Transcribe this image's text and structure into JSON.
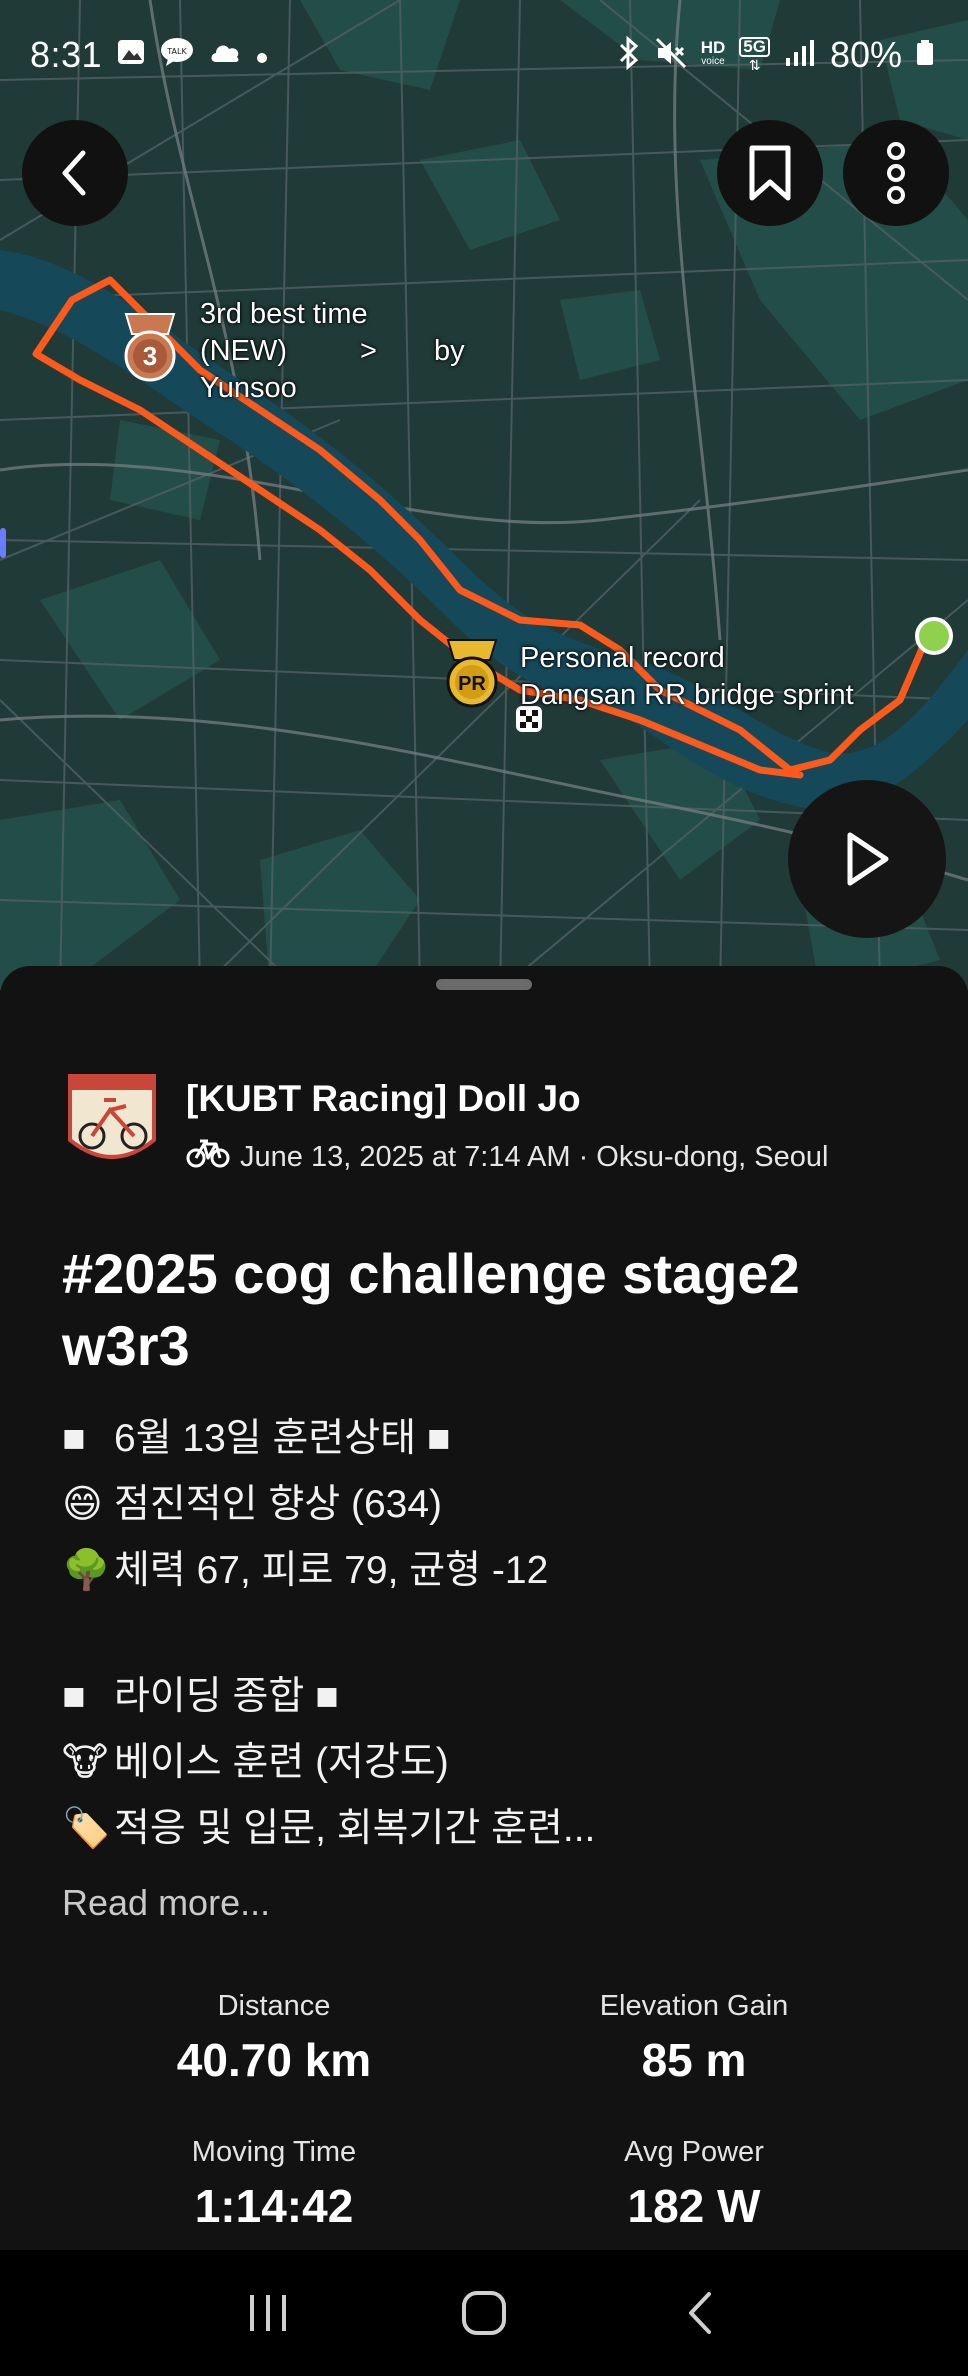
{
  "status_bar": {
    "time": "8:31",
    "left_icons": [
      "gallery-icon",
      "talk-icon",
      "cloud-icon",
      "dot-icon"
    ],
    "right_icons": [
      "bluetooth-icon",
      "mute-icon",
      "hd-voice-icon",
      "5g-icon",
      "signal-icon"
    ],
    "hd_label": "HD",
    "g5_label": "5G",
    "battery": "80%"
  },
  "map": {
    "best_time_label": [
      "3rd best time",
      "(NEW)",
      ">",
      "by",
      "Yunsoo"
    ],
    "best_time_medal": "3",
    "pr_label": [
      "Personal record",
      "Dangsan RR bridge sprint"
    ],
    "pr_medal": "PR",
    "colors": {
      "route": "#fc5a1c",
      "start_dot": "#8fd14f",
      "river": "#15495a",
      "land": "#1f3a37"
    }
  },
  "activity": {
    "athlete_name": "[KUBT Racing] Doll Jo",
    "meta": "June 13, 2025 at 7:14 AM · Oksu-dong, Seoul",
    "title": "#2025 cog challenge stage2 w3r3",
    "description": [
      {
        "emoji": "■",
        "text": "6월 13일 훈련상태 ■"
      },
      {
        "emoji": "😄",
        "text": "점진적인 향상 (634)"
      },
      {
        "emoji": "🌳",
        "text": "체력 67, 피로 79, 균형 -12"
      },
      {
        "emoji": "",
        "text": ""
      },
      {
        "emoji": "■",
        "text": "라이딩 종합 ■"
      },
      {
        "emoji": "🐮",
        "text": "베이스 훈련 (저강도)"
      },
      {
        "emoji": "🏷️",
        "text": "적응 및 입문, 회복기간 훈련..."
      }
    ],
    "read_more": "Read more...",
    "stats": [
      {
        "label": "Distance",
        "value": "40.70 km"
      },
      {
        "label": "Elevation Gain",
        "value": "85 m"
      },
      {
        "label": "Moving Time",
        "value": "1:14:42"
      },
      {
        "label": "Avg Power",
        "value": "182 W"
      }
    ]
  }
}
